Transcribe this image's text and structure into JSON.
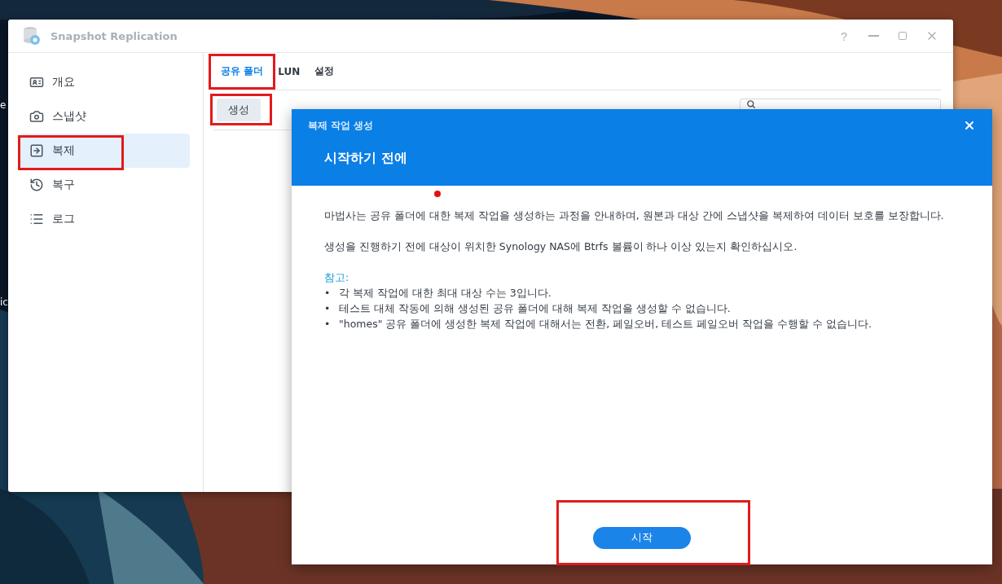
{
  "desktop": {
    "kind": "picture",
    "labels": [
      "e",
      "ic"
    ]
  },
  "window": {
    "title": "Snapshot Replication",
    "help": "?"
  },
  "sidebar": {
    "items": [
      {
        "kind": "overview",
        "label": "개요",
        "selected": false,
        "highlighted": false
      },
      {
        "kind": "snapshot",
        "label": "스냅샷",
        "selected": false,
        "highlighted": false
      },
      {
        "kind": "replication",
        "label": "복제",
        "selected": true,
        "highlighted": true
      },
      {
        "kind": "recovery",
        "label": "복구",
        "selected": false,
        "highlighted": false
      },
      {
        "kind": "log",
        "label": "로그",
        "selected": false,
        "highlighted": false
      }
    ]
  },
  "tabs": [
    {
      "label": "공유 폴더",
      "selected": true,
      "highlighted": true
    },
    {
      "label": "LUN",
      "selected": false,
      "highlighted": false
    },
    {
      "label": "설정",
      "selected": false,
      "highlighted": false
    }
  ],
  "toolbar": {
    "create_button": {
      "label": "생성",
      "highlighted": true
    }
  },
  "dialog": {
    "title": "복제 작업 생성",
    "heading": "시작하기 전에",
    "paragraphs": [
      "마법사는 공유 폴더에 대한 복제 작업을 생성하는 과정을 안내하며, 원본과 대상 간에 스냅샷을 복제하여 데이터 보호를 보장합니다.",
      "생성을 진행하기 전에 대상이 위치한 Synology NAS에 Btrfs 볼륨이 하나 이상 있는지 확인하십시오."
    ],
    "note_label": "참고:",
    "bullet": "•",
    "notes": [
      "각 복제 작업에 대한 최대 대상 수는 3입니다.",
      "테스트 대체 작동에 의해 생성된 공유 폴더에 대해 복제 작업을 생성할 수 없습니다.",
      "\"homes\" 공유 폴더에 생성한 복제 작업에 대해서는 전환, 페일오버, 테스트 페일오버 작업을 수행할 수 없습니다."
    ],
    "start_button": {
      "label": "시작",
      "highlighted": true
    }
  }
}
